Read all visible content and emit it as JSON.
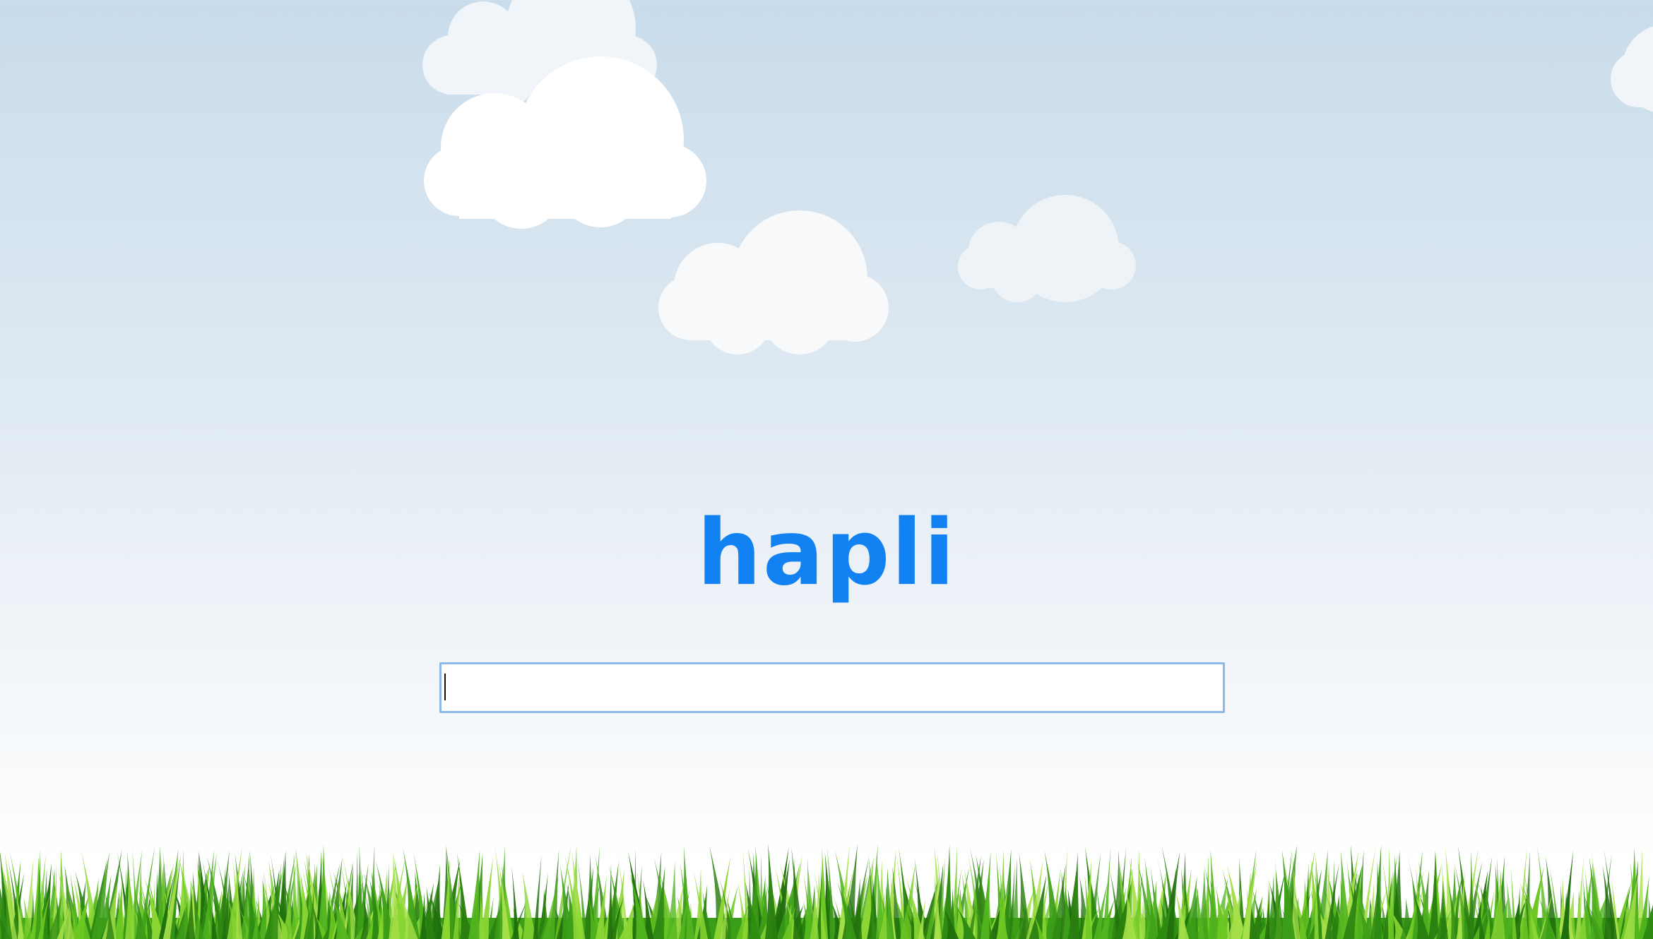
{
  "app": {
    "logo_text": "hapli",
    "logo_color": "#1282f3"
  },
  "search": {
    "value": "",
    "placeholder": "",
    "border_color": "#8db9ea"
  },
  "scene": {
    "sky_top_color": "#c9dceb",
    "sky_bottom_color": "#ffffff",
    "cloud_color": "#ffffff",
    "grass_dark": "#2e8b12",
    "grass_light": "#7ed321",
    "clouds": [
      {
        "name": "cloud-top-left-back",
        "opacity": 0.75
      },
      {
        "name": "cloud-top-left-front",
        "opacity": 1.0
      },
      {
        "name": "cloud-center",
        "opacity": 0.8
      },
      {
        "name": "cloud-center-right",
        "opacity": 0.7
      },
      {
        "name": "cloud-far-right-edge",
        "opacity": 0.7
      }
    ]
  }
}
